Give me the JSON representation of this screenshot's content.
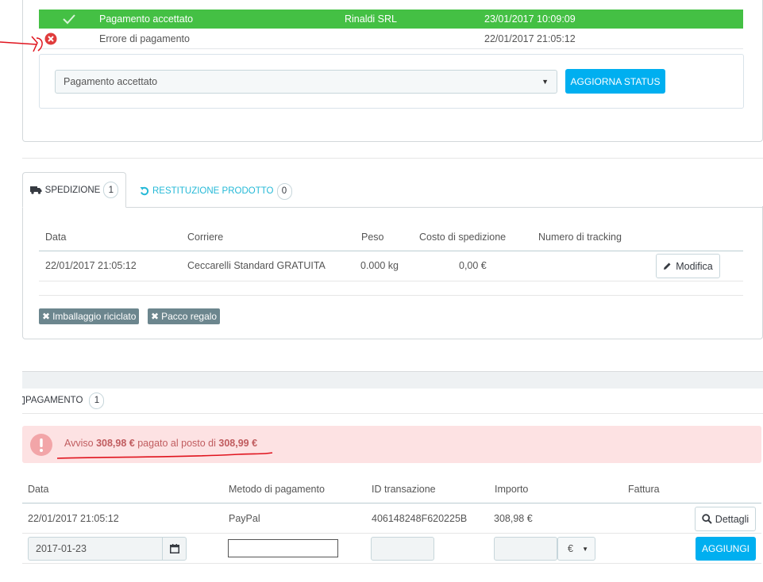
{
  "history": {
    "current": {
      "status": "Pagamento accettato",
      "employee": "Rinaldi SRL",
      "date": "23/01/2017 10:09:09"
    },
    "previous": {
      "status": "Errore di pagamento",
      "employee": "",
      "date": "22/01/2017 21:05:12"
    }
  },
  "status_form": {
    "selected": "Pagamento accettato",
    "button": "AGGIORNA STATUS"
  },
  "shipping_tabs": [
    {
      "label": "SPEDIZIONE",
      "count": "1"
    },
    {
      "label": "RESTITUZIONE PRODOTTO",
      "count": "0"
    }
  ],
  "shipping_table": {
    "headers": [
      "Data",
      "Corriere",
      "Peso",
      "Costo di spedizione",
      "Numero di tracking"
    ],
    "row": {
      "date": "22/01/2017 21:05:12",
      "carrier": "Ceccarelli Standard GRATUITA",
      "weight": "0.000 kg",
      "cost": "0,00 €",
      "tracking": ""
    },
    "edit_button": "Modifica"
  },
  "tags": [
    "Imballaggio riciclato",
    "Pacco regalo"
  ],
  "payment": {
    "title": "PAGAMENTO",
    "count": "1",
    "alert": {
      "prefix": "Avviso ",
      "paid": "308,98 €",
      "middle": " pagato al posto di ",
      "expected": "308,99 €"
    },
    "headers": [
      "Data",
      "Metodo di pagamento",
      "ID transazione",
      "Importo",
      "Fattura"
    ],
    "row": {
      "date": "22/01/2017 21:05:12",
      "method": "PayPal",
      "transaction_id": "406148248F620225B",
      "amount": "308,98 €"
    },
    "details_button": "Dettagli",
    "new": {
      "date": "2017-01-23",
      "currency": "€",
      "button": "AGGIUNGI"
    }
  },
  "colors": {
    "success": "#44c044",
    "primary": "#00aff0",
    "danger_bg": "#fde2e3",
    "danger_text": "#c05c5f",
    "annotation": "#e0141e"
  }
}
